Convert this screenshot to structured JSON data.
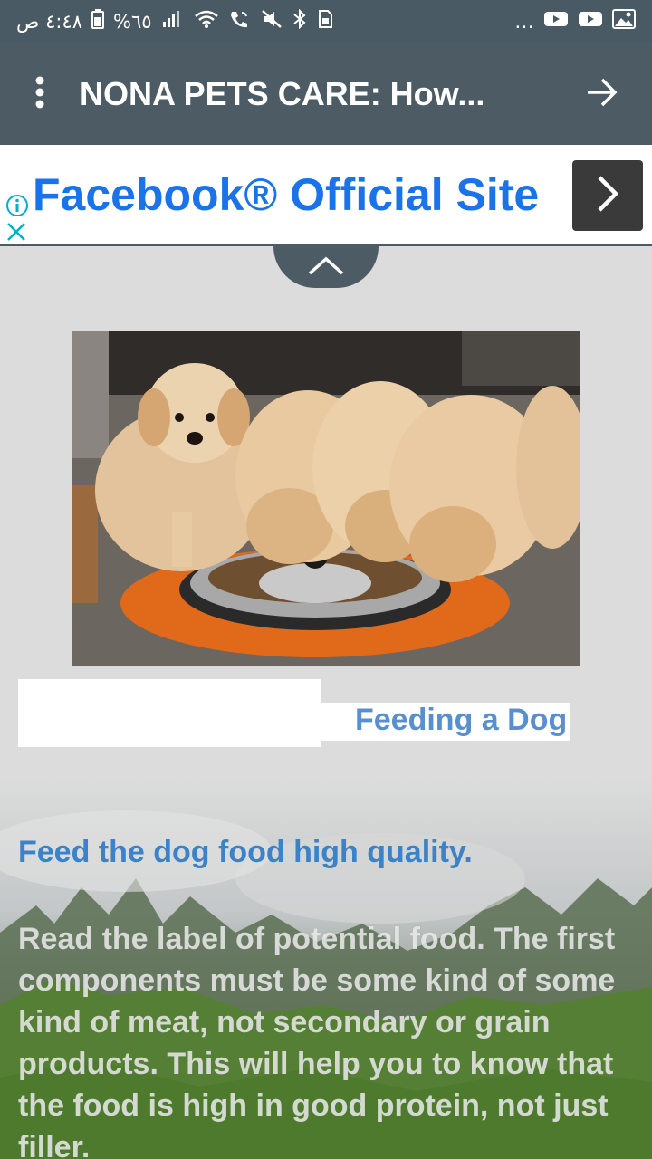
{
  "status_bar": {
    "time": "٤:٤٨ ص",
    "battery": "%٦٥",
    "more": "..."
  },
  "app_bar": {
    "title": "NONA PETS CARE: How..."
  },
  "ad": {
    "text": "Facebook® Official Site"
  },
  "article": {
    "photo_alt": "Golden retriever puppies eating from a bowl",
    "title": "Feeding a Dog",
    "heading": "Feed the dog food high quality.",
    "paragraph": "Read the label of potential food. The first components must be some kind of some kind of meat, not secondary or grain products. This will help you to know that the food is high in good protein, not just filler."
  },
  "colors": {
    "app_bar": "#4c5b64",
    "ad_link": "#1a73e8",
    "title": "#5a8fce",
    "heading": "#3b82c9"
  }
}
